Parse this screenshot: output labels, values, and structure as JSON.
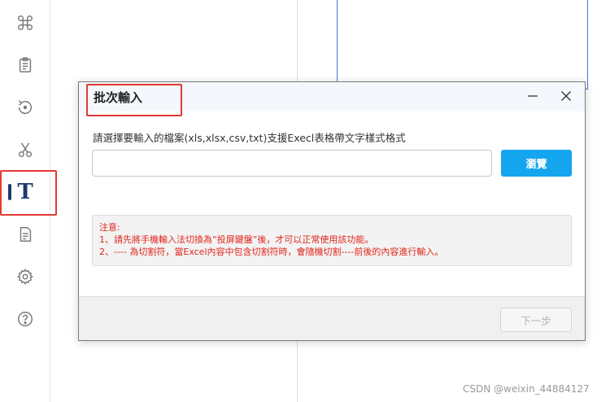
{
  "sidebar": {
    "items": [
      {
        "icon": "command-icon"
      },
      {
        "icon": "clipboard-icon"
      },
      {
        "icon": "refresh-icon"
      },
      {
        "icon": "scissors-icon"
      },
      {
        "icon": "text-icon",
        "glyph": "T",
        "active": true
      },
      {
        "icon": "document-icon"
      },
      {
        "icon": "gear-icon"
      },
      {
        "icon": "help-icon"
      }
    ]
  },
  "dialog": {
    "title": "批次輸入",
    "description": "請選擇要輸入的檔案(xls,xlsx,csv,txt)支援Execl表格帶文字樣式格式",
    "file_input": {
      "value": "",
      "placeholder": ""
    },
    "browse_label": "瀏覽",
    "notice": {
      "heading": "注意:",
      "line1": "1、請先將手機輸入法切換為“投屏鍵盤”後，才可以正常使用該功能。",
      "line2": "2、---- 為切割符，當Excel內容中包含切割符時，會隨機切割----前後的內容進行輸入。"
    },
    "next_label": "下一步",
    "next_enabled": false
  },
  "watermark": "CSDN @weixin_44884127",
  "colors": {
    "accent": "#14a5ef",
    "notice_text": "#e0261c",
    "highlight": "#e53935",
    "active_icon": "#1d3a6d"
  }
}
